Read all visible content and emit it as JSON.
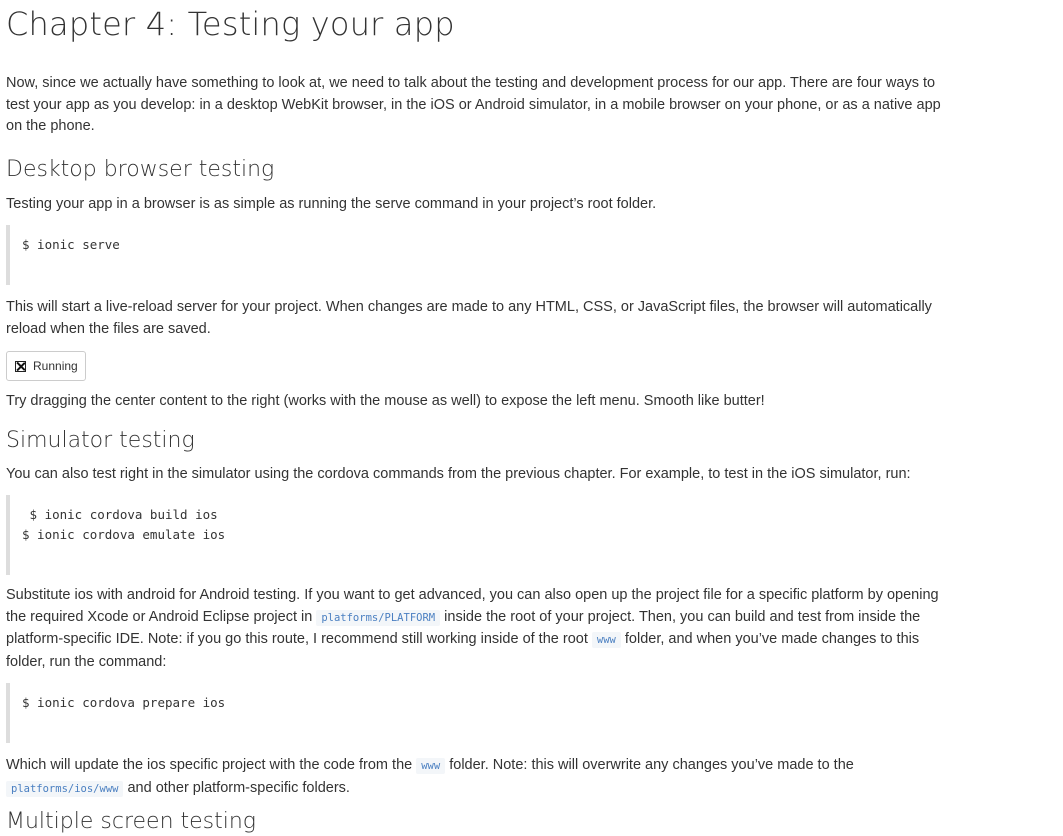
{
  "chapter_title": "Chapter 4: Testing your app",
  "intro": "Now, since we actually have something to look at, we need to talk about the testing and development process for our app. There are four ways to test your app as you develop: in a desktop WebKit browser, in the iOS or Android simulator, in a mobile browser on your phone, or as a native app on the phone.",
  "desktop": {
    "heading": "Desktop browser testing",
    "text": "Testing your app in a browser is as simple as running the serve command in your project’s root folder.",
    "code": "$ ionic serve",
    "livereload_text": "This will start a live-reload server for your project. When changes are made to any HTML, CSS, or JavaScript files, the browser will automatically reload when the files are saved.",
    "running_label": "Running",
    "drag_text": "Try dragging the center content to the right (works with the mouse as well) to expose the left menu. Smooth like butter!"
  },
  "simulator": {
    "heading": "Simulator testing",
    "text": "You can also test right in the simulator using the cordova commands from the previous chapter. For example, to test in the iOS simulator, run:",
    "code": " $ ionic cordova build ios\n$ ionic cordova emulate ios",
    "sub_part1": "Substitute ios with android for Android testing. If you want to get advanced, you can also open up the project file for a specific platform by opening the required Xcode or Android Eclipse project in ",
    "sub_code1": "platforms/PLATFORM",
    "sub_part2": " inside the root of your project. Then, you can build and test from inside the platform-specific IDE. Note: if you go this route, I recommend still working inside of the root ",
    "sub_code2": "www",
    "sub_part3": " folder, and when you’ve made changes to this folder, run the command:",
    "prepare_code": "$ ionic cordova prepare ios",
    "update_part1": "Which will update the ios specific project with the code from the ",
    "update_code1": "www",
    "update_part2": " folder. Note: this will overwrite any changes you’ve made to the ",
    "update_code2": "platforms/ios/www",
    "update_part3": " and other platform-specific folders."
  },
  "next_heading": "Multiple screen testing"
}
